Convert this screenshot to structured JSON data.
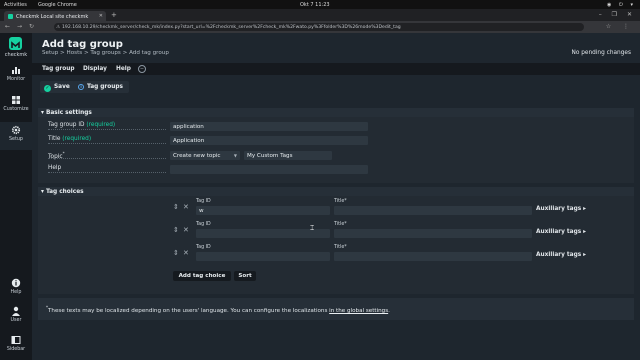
{
  "os": {
    "activities": "Activities",
    "app": "Google Chrome",
    "clock": "Okt 7  11:23"
  },
  "browser": {
    "tab_title": "Checkmk Local site checkmk",
    "url": "192.168.10.29/checkmk_server/check_mk/index.py?start_url=%2Fcheckmk_server%2Fcheck_mk%2Fwato.py%3Ffolder%3D%26mode%3Dedit_tag"
  },
  "sidebar": {
    "logo_text": "checkmk",
    "items": [
      {
        "label": "Monitor",
        "icon": "monitor-icon"
      },
      {
        "label": "Customize",
        "icon": "customize-icon"
      },
      {
        "label": "Setup",
        "icon": "setup-gear-icon"
      },
      {
        "label": "Help",
        "icon": "help-icon"
      },
      {
        "label": "User",
        "icon": "user-icon"
      },
      {
        "label": "Sidebar",
        "icon": "sidebar-icon"
      }
    ]
  },
  "header": {
    "title": "Add tag group",
    "breadcrumb": "Setup > Hosts > Tag groups > Add tag group",
    "pending": "No pending changes"
  },
  "menu": {
    "items": [
      "Tag group",
      "Display",
      "Help"
    ],
    "toggle": "−"
  },
  "actions": {
    "save": "Save",
    "tag_groups": "Tag groups"
  },
  "basic": {
    "header": "Basic settings",
    "fields": {
      "tag_group_id": {
        "label": "Tag group ID",
        "req": "(required)",
        "value": "application"
      },
      "title": {
        "label": "Title",
        "req": "(required)",
        "value": "Application"
      },
      "topic": {
        "label": "Topic",
        "mark": "*",
        "select": "Create new topic",
        "value": "My Custom Tags"
      },
      "help": {
        "label": "Help",
        "value": ""
      }
    }
  },
  "choices": {
    "header": "Tag choices",
    "col_tag_id": "Tag ID",
    "col_title": "Title*",
    "aux_label": "Auxiliary tags ▸",
    "rows": [
      {
        "tag_id": "w",
        "title": ""
      },
      {
        "tag_id": "",
        "title": ""
      },
      {
        "tag_id": "",
        "title": ""
      }
    ],
    "add_button": "Add tag choice",
    "sort_button": "Sort"
  },
  "footnote": {
    "mark": "*",
    "text": "These texts may be localized depending on the users' language. You can configure the localizations ",
    "link": "in the global settings",
    "end": "."
  },
  "colors": {
    "accent": "#15d1a0",
    "bg": "#1e262e",
    "sidebar": "#15191e"
  }
}
